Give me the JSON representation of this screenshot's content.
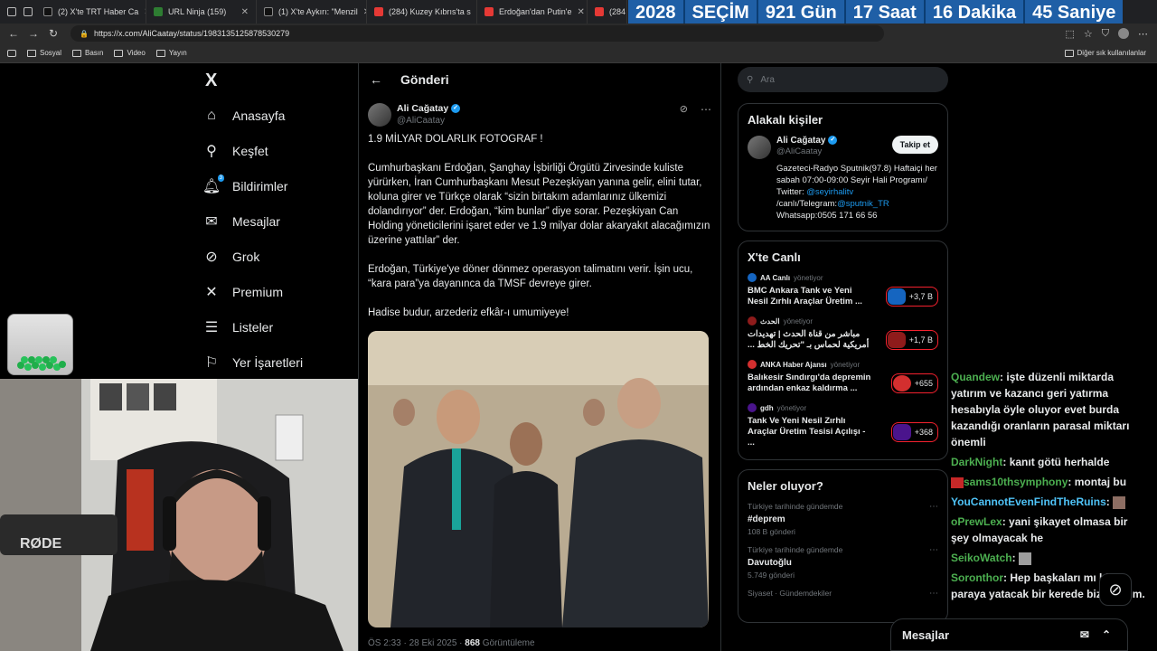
{
  "browser": {
    "tabs": [
      {
        "title": "(2) X'te TRT Haber Ca",
        "color": "#444"
      },
      {
        "title": "URL Ninja (159)",
        "color": "#2e7d32"
      },
      {
        "title": "(1) X'te Aykırı: \"Menzil",
        "color": "#444"
      },
      {
        "title": "(284) Kuzey Kıbrıs'ta s",
        "color": "#e53935"
      },
      {
        "title": "Erdoğan'dan Putin'e",
        "color": "#e53935"
      },
      {
        "title": "(284",
        "color": "#e53935"
      }
    ],
    "url": "https://x.com/AliCaatay/status/1983135125878530279",
    "bookmarks": [
      "Sosyal",
      "Basın",
      "Video",
      "Yayın"
    ],
    "other_bookmarks": "Diğer sık kullanılanlar"
  },
  "countdown": {
    "year": "2028",
    "label": "SEÇİM",
    "days": "921 Gün",
    "hours": "17 Saat",
    "minutes": "16 Dakika",
    "seconds": "45 Saniye"
  },
  "sidebar": {
    "logo": "X",
    "items": [
      {
        "label": "Anasayfa",
        "icon": "home-icon"
      },
      {
        "label": "Keşfet",
        "icon": "search-icon"
      },
      {
        "label": "Bildirimler",
        "icon": "bell-icon",
        "badge": "3"
      },
      {
        "label": "Mesajlar",
        "icon": "mail-icon"
      },
      {
        "label": "Grok",
        "icon": "grok-icon"
      },
      {
        "label": "Premium",
        "icon": "x-icon"
      },
      {
        "label": "Listeler",
        "icon": "list-icon"
      },
      {
        "label": "Yer İşaretleri",
        "icon": "bookmark-icon"
      }
    ]
  },
  "main": {
    "header": "Gönderi",
    "tweet": {
      "author": "Ali Cağatay",
      "handle": "@AliCaatay",
      "paragraphs": [
        "1.9 MİLYAR DOLARLIK FOTOGRAF !",
        "Cumhurbaşkanı Erdoğan, Şanghay İşbirliği Örgütü Zirvesinde kuliste yürürken, İran Cumhurbaşkanı Mesut Pezeşkiyan yanına gelir, elini tutar, koluna girer ve Türkçe olarak “sizin birtakım adamlarınız ülkemizi dolandırıyor” der. Erdoğan, “kim bunlar” diye sorar. Pezeşkiyan Can Holding yöneticilerini işaret eder ve 1.9 milyar dolar akaryakıt alacağımızın üzerine yattılar” der.",
        "Erdoğan, Türkiye'ye döner dönmez operasyon talimatını verir. İşin ucu, “kara para”ya dayanınca da TMSF devreye girer.",
        "Hadise budur, arzederiz efkâr-ı umumiyeye!"
      ],
      "time": "ÖS 2:33 · 28 Eki 2025 ·",
      "views": "868",
      "views_label": "Görüntüleme"
    }
  },
  "right": {
    "search_placeholder": "Ara",
    "related": {
      "title": "Alakalı kişiler",
      "name": "Ali Cağatay",
      "handle": "@AliCaatay",
      "follow": "Takip et",
      "bio_1": "Gazeteci-Radyo Sputnik(97.8) Haftaiçi her sabah 07:00-09:00 Seyir Hali Programı/ Twitter:",
      "bio_link_1": "@seyirhalitv",
      "bio_2": "/canlı/Telegram:",
      "bio_link_2": "@sputnik_TR",
      "bio_3": "Whatsapp:0505 171 66 56"
    },
    "live": {
      "title": "X'te Canlı",
      "items": [
        {
          "source": "AA Canlı",
          "role": "yönetiyor",
          "title": "BMC Ankara Tank ve Yeni Nesil Zırhlı Araçlar Üretim ...",
          "count": "+3,7 B",
          "thumb": "#1565c0"
        },
        {
          "source": "الحدث",
          "role": "yönetiyor",
          "title": "مباشر من قناة الحدث | تهديدات أمريكية لحماس بـ \"تحريك الخط ...",
          "count": "+1,7 B",
          "thumb": "#8e1b1b"
        },
        {
          "source": "ANKA Haber Ajansı",
          "role": "yönetiyor",
          "title": "Balıkesir Sındırgı'da depremin ardından enkaz kaldırma ...",
          "count": "+655",
          "thumb": "#d32f2f"
        },
        {
          "source": "gdh",
          "role": "yönetiyor",
          "title": "Tank Ve Yeni Nesil Zırhlı Araçlar Üretim Tesisi Açılışı - ...",
          "count": "+368",
          "thumb": "#4a148c"
        }
      ]
    },
    "trends": {
      "title": "Neler oluyor?",
      "items": [
        {
          "category": "Türkiye tarihinde gündemde",
          "name": "#deprem",
          "count": "108 B gönderi"
        },
        {
          "category": "Türkiye tarihinde gündemde",
          "name": "Davutoğlu",
          "count": "5.749 gönderi"
        },
        {
          "category": "Siyaset · Gündemdekiler",
          "name": "",
          "count": ""
        }
      ]
    },
    "messages": "Mesajlar"
  },
  "chat": [
    {
      "user": "Quandew",
      "color": "#4caf50",
      "msg": "işte düzenli miktarda yatırım ve kazancı geri yatırma hesabıyla öyle oluyor evet burda kazandığı oranların parasal miktarı önemli"
    },
    {
      "user": "DarkNight",
      "color": "#4caf50",
      "msg": "kanıt götü herhalde"
    },
    {
      "user": "sams10thsymphony",
      "color": "#4caf50",
      "msg": "montaj bu"
    },
    {
      "user": "YouCannotEvenFindTheRuins",
      "color": "#4fc3f7",
      "msg": ""
    },
    {
      "user": "oPrewLex",
      "color": "#4caf50",
      "msg": "yani şikayet olmasa bir şey olmayacak he"
    },
    {
      "user": "SeikoWatch",
      "color": "#4caf50",
      "msg": ""
    },
    {
      "user": "Soronthor",
      "color": "#4caf50",
      "msg": "Hep başkaları mı bizim paraya yatacak bir kerede biz yatalım."
    }
  ]
}
